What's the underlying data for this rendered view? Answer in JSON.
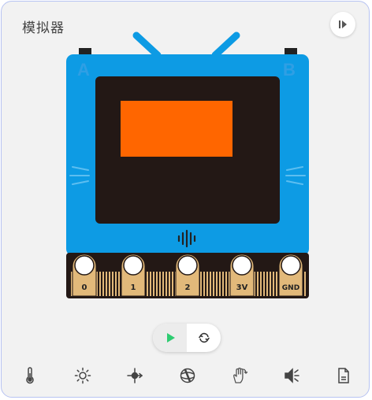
{
  "header": {
    "title": "模拟器",
    "collapse_icon": "play-step-icon"
  },
  "device": {
    "button_a": "A",
    "button_b": "B",
    "screen_color": "#ff6600",
    "body_color": "#0d9be4",
    "pins": [
      "0",
      "1",
      "2",
      "3V",
      "GND"
    ]
  },
  "controls": {
    "run_icon": "play-icon",
    "reset_icon": "refresh-icon",
    "run_color": "#2ecc71"
  },
  "sensors": [
    "thermometer-icon",
    "brightness-icon",
    "compass-icon",
    "gesture-icon",
    "hand-rotate-icon",
    "speaker-icon",
    "file-icon"
  ]
}
